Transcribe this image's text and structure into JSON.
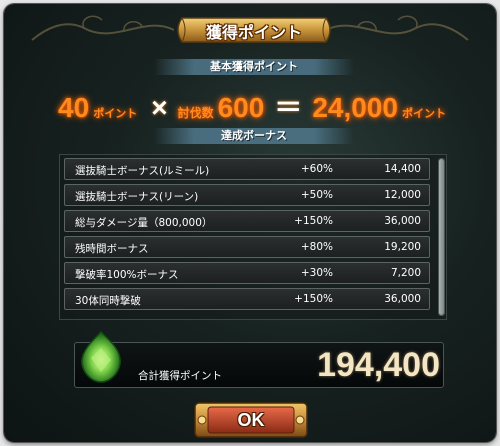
{
  "header": {
    "title": "獲得ポイント"
  },
  "base": {
    "label": "基本獲得ポイント",
    "points_value": "40",
    "points_unit": "ポイント",
    "multiply_sign": "×",
    "kills_label": "討伐数",
    "kills_value": "600",
    "equals_sign": "＝",
    "result_value": "24,000",
    "result_unit": "ポイント"
  },
  "bonus": {
    "label": "達成ボーナス",
    "rows": [
      {
        "name": "選抜騎士ボーナス(ルミール)",
        "rate": "+60%",
        "points": "14,400"
      },
      {
        "name": "選抜騎士ボーナス(リーン)",
        "rate": "+50%",
        "points": "12,000"
      },
      {
        "name": "総与ダメージ量（800,000）",
        "rate": "+150%",
        "points": "36,000"
      },
      {
        "name": "残時間ボーナス",
        "rate": "+80%",
        "points": "19,200"
      },
      {
        "name": "撃破率100%ボーナス",
        "rate": "+30%",
        "points": "7,200"
      },
      {
        "name": "30体同時撃破",
        "rate": "+150%",
        "points": "36,000"
      }
    ]
  },
  "total": {
    "label": "合計獲得ポイント",
    "value": "194,400"
  },
  "ok_button": {
    "label": "OK"
  },
  "icons": {
    "gem": "green-gem-icon"
  },
  "colors": {
    "accent_orange": "#ff8a1e",
    "total_value": "#f4e6c4",
    "banner_gold": "#c8953a"
  }
}
